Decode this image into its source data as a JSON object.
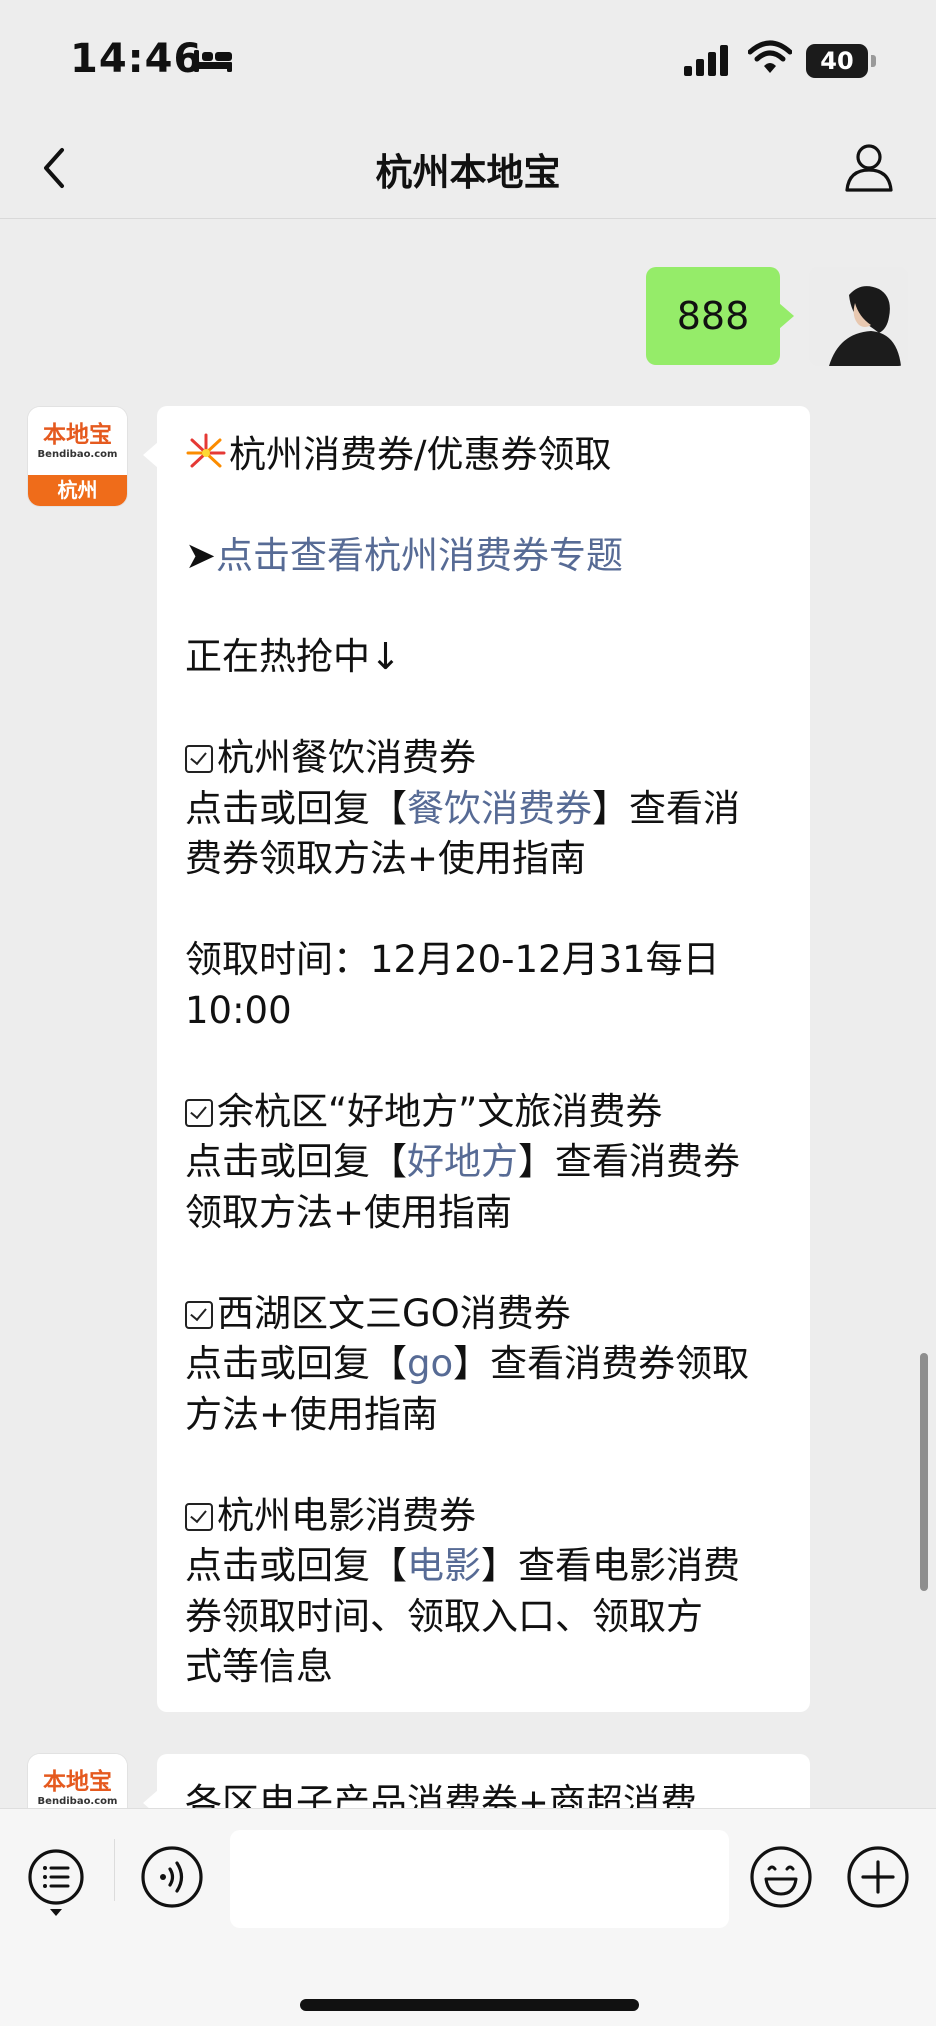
{
  "status_bar": {
    "time": "14:46",
    "battery_level": "40",
    "icons": [
      "bed-icon",
      "signal-icon",
      "wifi-icon",
      "battery-icon"
    ]
  },
  "nav": {
    "title": "杭州本地宝",
    "icons": [
      "back-icon",
      "profile-icon"
    ]
  },
  "sent_message": {
    "text": "888"
  },
  "account": {
    "avatar_brand": "本地宝",
    "avatar_domain": "Bendibao.com",
    "avatar_city": "杭州"
  },
  "message1": {
    "title": "杭州消费券/优惠券领取",
    "title_icon": "fireworks-icon",
    "topic_arrow": "➤",
    "topic_link": "点击查看杭州消费券专题",
    "hot": "正在热抢中↓",
    "sections": [
      {
        "heading": "杭州餐饮消费券",
        "line1_prefix": "点击或回复【",
        "keyword": "餐饮消费券",
        "line1_suffix": "】查看消",
        "line2": "费券领取方法+使用指南"
      },
      {
        "time_line1": "领取时间：12月20-12月31每日",
        "time_line2": "10:00"
      },
      {
        "heading": "余杭区“好地方”文旅消费券",
        "line1_prefix": "点击或回复【",
        "keyword": "好地方",
        "line1_suffix": "】查看消费券",
        "line2": "领取方法+使用指南"
      },
      {
        "heading": "西湖区文三GO消费券",
        "line1_prefix": "点击或回复【",
        "keyword": "go",
        "line1_suffix": "】查看消费券领取",
        "line2": "方法+使用指南"
      },
      {
        "heading": "杭州电影消费券",
        "line1_prefix": "点击或回复【",
        "keyword": "电影",
        "line1_suffix": "】查看电影消费",
        "line2": "券领取时间、领取入口、领取方",
        "line3": "式等信息"
      }
    ]
  },
  "message2": {
    "first_line": "各区电子产品消费券+商超消费"
  },
  "input_bar": {
    "placeholder": "",
    "icons": [
      "menu-icon",
      "voice-icon",
      "emoji-icon",
      "plus-icon"
    ]
  },
  "colors": {
    "background": "#ededed",
    "sent_bubble": "#95ec69",
    "link": "#576b95",
    "brand_orange": "#ef6c1a"
  }
}
